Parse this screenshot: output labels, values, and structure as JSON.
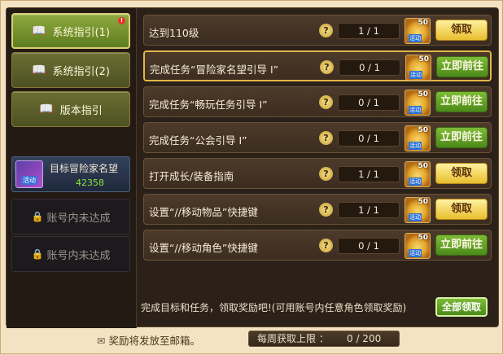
{
  "sidebar": {
    "buttons": [
      {
        "label": "系统指引(1)",
        "badge": "!"
      },
      {
        "label": "系统指引(2)"
      },
      {
        "label": "版本指引"
      }
    ],
    "target": {
      "title": "目标冒险家名望",
      "value": "42358",
      "icon_tag": "活动"
    },
    "locked": [
      {
        "label": "账号内未达成"
      },
      {
        "label": "账号内未达成"
      }
    ]
  },
  "tasks": [
    {
      "name": "达到110级",
      "progress": "1 / 1",
      "reward_count": "50",
      "reward_tag": "活动",
      "action": "领取",
      "action_type": "claim"
    },
    {
      "name": "完成任务“冒险家名望引导 I”",
      "progress": "0 / 1",
      "reward_count": "50",
      "reward_tag": "活动",
      "action": "立即前往",
      "action_type": "go"
    },
    {
      "name": "完成任务“畅玩任务引导 I”",
      "progress": "0 / 1",
      "reward_count": "50",
      "reward_tag": "活动",
      "action": "立即前往",
      "action_type": "go"
    },
    {
      "name": "完成任务“公会引导 I”",
      "progress": "0 / 1",
      "reward_count": "50",
      "reward_tag": "活动",
      "action": "立即前往",
      "action_type": "go"
    },
    {
      "name": "打开成长/装备指南",
      "progress": "1 / 1",
      "reward_count": "50",
      "reward_tag": "活动",
      "action": "领取",
      "action_type": "claim"
    },
    {
      "name": "设置“//移动物品”快捷键",
      "progress": "1 / 1",
      "reward_count": "50",
      "reward_tag": "活动",
      "action": "领取",
      "action_type": "claim"
    },
    {
      "name": "设置“//移动角色”快捷键",
      "progress": "0 / 1",
      "reward_count": "50",
      "reward_tag": "活动",
      "action": "立即前往",
      "action_type": "go"
    }
  ],
  "note": "完成目标和任务，领取奖励吧!(可用账号内任意角色领取奖励)",
  "claim_all_label": "全部领取",
  "footer": {
    "mail_note": "奖励将发放至邮箱。",
    "weekly_label": "每周获取上限 ：",
    "weekly_value": "0 / 200"
  },
  "colors": {
    "claim": "#e8bf2f",
    "go": "#4c8a19",
    "panel": "#2b2119"
  },
  "icons": {
    "book": "book-icon",
    "lock": "lock-icon",
    "help": "question-icon",
    "mail": "envelope-icon"
  }
}
